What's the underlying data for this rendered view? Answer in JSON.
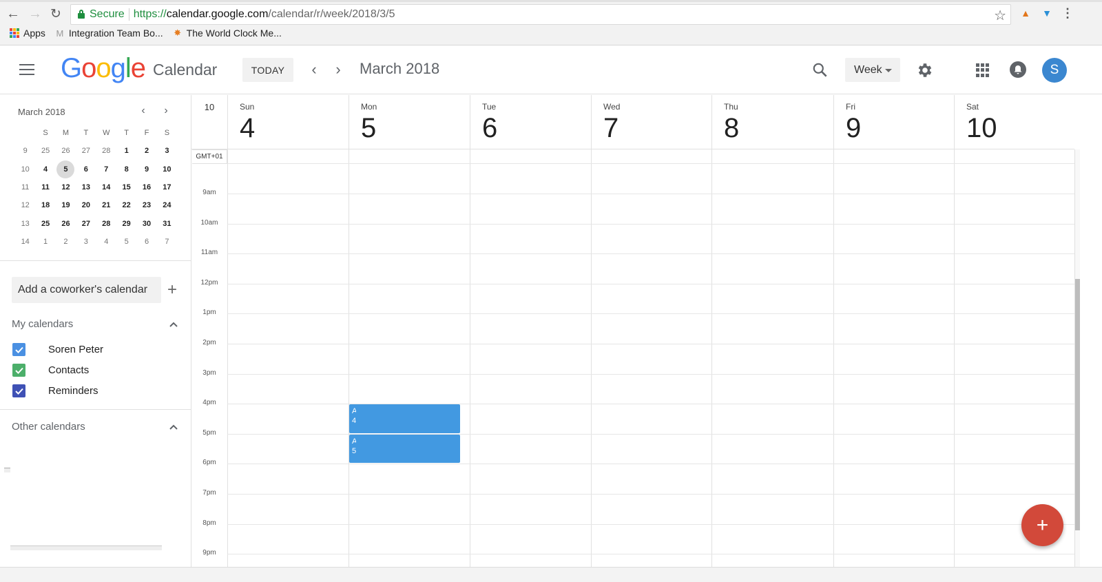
{
  "browser": {
    "secure_label": "Secure",
    "url_scheme": "https://",
    "url_host": "calendar.google.com",
    "url_path": "/calendar/r/week/2018/3/5",
    "bookmarks": [
      {
        "label": "Apps",
        "icon": "apps-grid-icon"
      },
      {
        "label": "Integration Team Bo...",
        "icon": "gmail-icon"
      },
      {
        "label": "The World Clock Me...",
        "icon": "world-clock-icon"
      }
    ],
    "extensions": [
      "metamask-fox-icon",
      "blue-diamond-extension-icon"
    ]
  },
  "header": {
    "logo_letters": [
      "G",
      "o",
      "o",
      "g",
      "l",
      "e"
    ],
    "product": "Calendar",
    "today_label": "TODAY",
    "prev_icon": "‹",
    "next_icon": "›",
    "date_title": "March 2018",
    "view_selected": "Week",
    "avatar_initial": "S"
  },
  "mini_calendar": {
    "title": "March 2018",
    "prev_icon": "‹",
    "next_icon": "›",
    "dow": [
      "S",
      "M",
      "T",
      "W",
      "T",
      "F",
      "S"
    ],
    "weeks": [
      {
        "wk": "9",
        "days": [
          {
            "d": "25",
            "o": true
          },
          {
            "d": "26",
            "o": true
          },
          {
            "d": "27",
            "o": true
          },
          {
            "d": "28",
            "o": true
          },
          {
            "d": "1"
          },
          {
            "d": "2"
          },
          {
            "d": "3"
          }
        ]
      },
      {
        "wk": "10",
        "days": [
          {
            "d": "4"
          },
          {
            "d": "5",
            "sel": true
          },
          {
            "d": "6"
          },
          {
            "d": "7"
          },
          {
            "d": "8"
          },
          {
            "d": "9"
          },
          {
            "d": "10"
          }
        ]
      },
      {
        "wk": "11",
        "days": [
          {
            "d": "11"
          },
          {
            "d": "12"
          },
          {
            "d": "13"
          },
          {
            "d": "14"
          },
          {
            "d": "15"
          },
          {
            "d": "16"
          },
          {
            "d": "17"
          }
        ]
      },
      {
        "wk": "12",
        "days": [
          {
            "d": "18"
          },
          {
            "d": "19"
          },
          {
            "d": "20"
          },
          {
            "d": "21"
          },
          {
            "d": "22"
          },
          {
            "d": "23"
          },
          {
            "d": "24"
          }
        ]
      },
      {
        "wk": "13",
        "days": [
          {
            "d": "25"
          },
          {
            "d": "26"
          },
          {
            "d": "27"
          },
          {
            "d": "28"
          },
          {
            "d": "29"
          },
          {
            "d": "30"
          },
          {
            "d": "31"
          }
        ]
      },
      {
        "wk": "14",
        "days": [
          {
            "d": "1",
            "o": true
          },
          {
            "d": "2",
            "o": true
          },
          {
            "d": "3",
            "o": true
          },
          {
            "d": "4",
            "o": true
          },
          {
            "d": "5",
            "o": true
          },
          {
            "d": "6",
            "o": true
          },
          {
            "d": "7",
            "o": true
          }
        ]
      }
    ]
  },
  "sidebar": {
    "coworker_placeholder": "Add a coworker's calendar",
    "my_calendars_label": "My calendars",
    "other_calendars_label": "Other calendars",
    "my_calendars": [
      {
        "label": "Soren Peter",
        "color": "#4a90e2",
        "checked": true
      },
      {
        "label": "Contacts",
        "color": "#4caf6a",
        "checked": true
      },
      {
        "label": "Reminders",
        "color": "#3f51b5",
        "checked": true
      }
    ]
  },
  "week": {
    "week_number": "10",
    "timezone": "GMT+01",
    "days": [
      {
        "name": "Sun",
        "date": "4"
      },
      {
        "name": "Mon",
        "date": "5"
      },
      {
        "name": "Tue",
        "date": "6"
      },
      {
        "name": "Wed",
        "date": "7"
      },
      {
        "name": "Thu",
        "date": "8"
      },
      {
        "name": "Fri",
        "date": "9"
      },
      {
        "name": "Sat",
        "date": "10"
      }
    ],
    "hours": [
      "9am",
      "10am",
      "11am",
      "12pm",
      "1pm",
      "2pm",
      "3pm",
      "4pm",
      "5pm",
      "6pm",
      "7pm",
      "8pm",
      "9pm"
    ],
    "events": [
      {
        "day": "Mon",
        "start": "4pm",
        "end": "5pm",
        "text_fragment": [
          "A",
          "4"
        ],
        "color": "#4299e1"
      },
      {
        "day": "Mon",
        "start": "5pm",
        "end": "6pm",
        "text_fragment": [
          "A",
          "5"
        ],
        "color": "#4299e1"
      }
    ]
  },
  "fab": {
    "icon": "+"
  }
}
